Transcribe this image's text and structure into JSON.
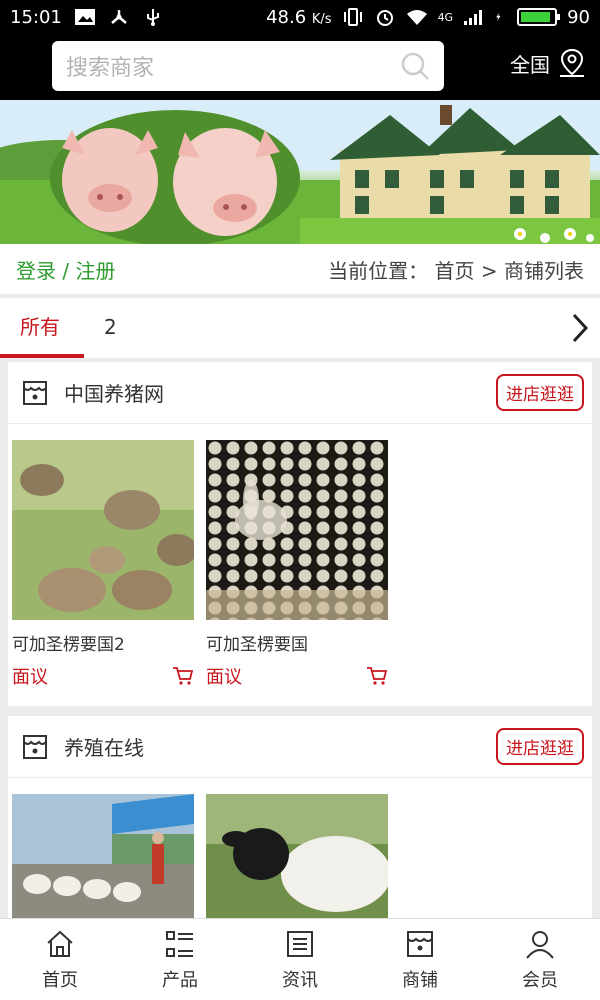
{
  "status_bar": {
    "time": "15:01",
    "speed": "48.6",
    "speed_unit": "K/s",
    "network": "4G",
    "battery": "90",
    "battery_level": 0.9
  },
  "search": {
    "placeholder": "搜索商家",
    "icon": "search-icon"
  },
  "region": {
    "label": "全国",
    "icon": "map-pin-icon"
  },
  "auth": {
    "login_register": "登录 / 注册"
  },
  "breadcrumb": {
    "text": "当前位置： 首页 > 商铺列表"
  },
  "tabs": [
    {
      "label": "所有",
      "active": true
    },
    {
      "label": "2",
      "active": false
    }
  ],
  "shops": [
    {
      "name": "中国养猪网",
      "visit_label": "进店逛逛",
      "products": [
        {
          "name": "可加圣楞要国2",
          "price": "面议"
        },
        {
          "name": "可加圣楞要国",
          "price": "面议"
        }
      ]
    },
    {
      "name": "养殖在线",
      "visit_label": "进店逛逛",
      "products": [
        {
          "name": "",
          "price": ""
        },
        {
          "name": "",
          "price": ""
        }
      ]
    }
  ],
  "bottom_nav": [
    {
      "label": "首页",
      "icon": "home-icon"
    },
    {
      "label": "产品",
      "icon": "list-icon"
    },
    {
      "label": "资讯",
      "icon": "news-icon"
    },
    {
      "label": "商铺",
      "icon": "shop-icon"
    },
    {
      "label": "会员",
      "icon": "user-icon"
    }
  ],
  "colors": {
    "accent": "#c9151e",
    "login_green": "#2e9b2e",
    "header_bg": "#000000"
  }
}
